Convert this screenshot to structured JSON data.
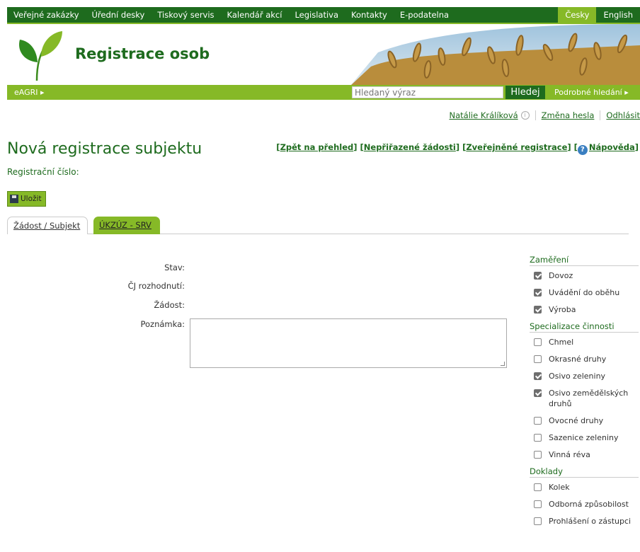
{
  "top_nav": {
    "items": [
      "Veřejné zakázky",
      "Úřední desky",
      "Tiskový servis",
      "Kalendář akcí",
      "Legislativa",
      "Kontakty",
      "E-podatelna"
    ],
    "lang_cz": "Česky",
    "lang_en": "English"
  },
  "header": {
    "title": "Registrace osob"
  },
  "green_bar": {
    "eagri": "eAGRI ▸",
    "search_placeholder": "Hledaný výraz",
    "search_button": "Hledej",
    "advanced_search": "Podrobné hledání ▸"
  },
  "user": {
    "name": "Natálie Králíková",
    "change_password": "Změna hesla",
    "logout": "Odhlásit"
  },
  "page": {
    "title": "Nová registrace subjektu",
    "back": "Zpět na přehled",
    "unassigned": "Nepřiřazené žádosti",
    "published": "Zveřejněné registrace",
    "help": "Nápověda",
    "reg_number_label": "Registrační číslo:",
    "save_label": "Uložit"
  },
  "tabs": [
    {
      "label": "Žádost / Subjekt",
      "active": false
    },
    {
      "label": "ÚKZÚZ - SRV",
      "active": true
    }
  ],
  "form": {
    "stav": "Stav:",
    "cj": "ČJ rozhodnutí:",
    "zadost": "Žádost:",
    "poznamka": "Poznámka:"
  },
  "sidebar": {
    "zamereni": {
      "title": "Zaměření",
      "items": [
        {
          "label": "Dovoz",
          "checked": true
        },
        {
          "label": "Uvádění do oběhu",
          "checked": true
        },
        {
          "label": "Výroba",
          "checked": true
        }
      ]
    },
    "specializace": {
      "title": "Specializace činnosti",
      "items": [
        {
          "label": "Chmel",
          "checked": false
        },
        {
          "label": "Okrasné druhy",
          "checked": false
        },
        {
          "label": "Osivo zeleniny",
          "checked": true
        },
        {
          "label": "Osivo zemědělských druhů",
          "checked": true
        },
        {
          "label": "Ovocné druhy",
          "checked": false
        },
        {
          "label": "Sazenice zeleniny",
          "checked": false
        },
        {
          "label": "Vinná réva",
          "checked": false
        }
      ]
    },
    "doklady": {
      "title": "Doklady",
      "items": [
        {
          "label": "Kolek",
          "checked": false
        },
        {
          "label": "Odborná způsobilost",
          "checked": false
        },
        {
          "label": "Prohlášení o zástupci",
          "checked": false
        }
      ]
    }
  }
}
